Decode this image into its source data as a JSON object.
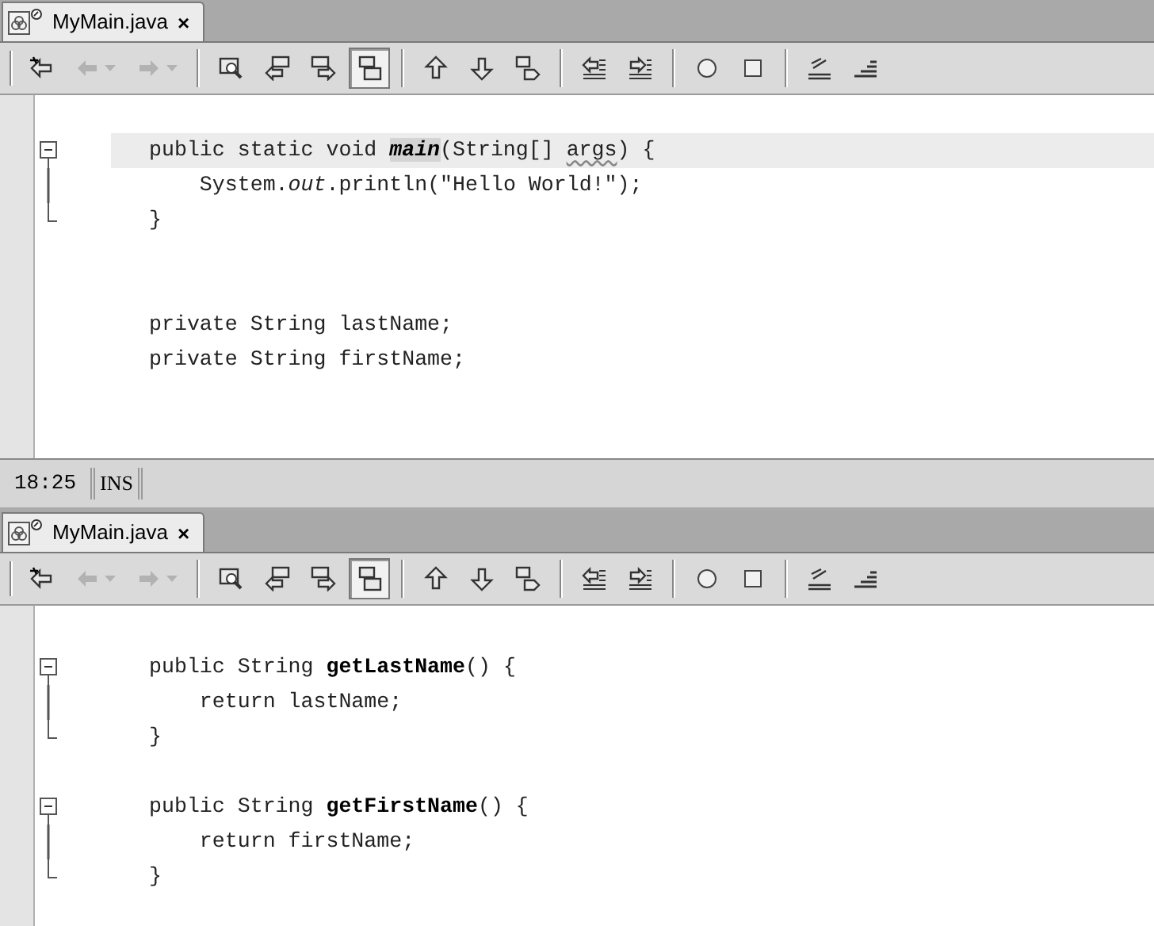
{
  "top_editor": {
    "tab": {
      "label": "MyMain.java",
      "close": "×",
      "selected": true
    },
    "toolbar": {
      "buttons": [
        {
          "pressed": false,
          "disabled": false
        },
        {
          "pressed": false,
          "disabled": true
        },
        {
          "pressed": false,
          "disabled": true
        },
        {
          "pressed": false,
          "disabled": false
        },
        {
          "pressed": false,
          "disabled": false
        },
        {
          "pressed": false,
          "disabled": false
        },
        {
          "pressed": true,
          "disabled": false
        },
        {
          "pressed": false,
          "disabled": false
        },
        {
          "pressed": false,
          "disabled": false
        },
        {
          "pressed": false,
          "disabled": false
        },
        {
          "pressed": false,
          "disabled": false
        },
        {
          "pressed": false,
          "disabled": false
        },
        {
          "pressed": false,
          "disabled": false
        },
        {
          "pressed": false,
          "disabled": false
        },
        {
          "pressed": false,
          "disabled": false
        },
        {
          "pressed": false,
          "disabled": false
        }
      ]
    },
    "lines": [
      {
        "kind": "open",
        "current": true,
        "segments": [
          {
            "text": "public static void ",
            "kind": "text"
          },
          {
            "text": "main",
            "kind": "marked"
          },
          {
            "text": "(String[] ",
            "kind": "text"
          },
          {
            "text": "args",
            "kind": "warning"
          },
          {
            "text": ") {",
            "kind": "text"
          }
        ]
      },
      {
        "kind": "body",
        "current": false,
        "segments": [
          {
            "text": "    System.",
            "kind": "text"
          },
          {
            "text": "out",
            "kind": "field"
          },
          {
            "text": ".println(\"Hello World!\");",
            "kind": "text"
          }
        ]
      },
      {
        "kind": "close",
        "current": false,
        "segments": [
          {
            "text": "}",
            "kind": "text"
          }
        ]
      },
      {
        "kind": "blank"
      },
      {
        "kind": "blank"
      },
      {
        "kind": "plain",
        "current": false,
        "segments": [
          {
            "text": "private String lastName;",
            "kind": "text"
          }
        ]
      },
      {
        "kind": "plain",
        "current": false,
        "segments": [
          {
            "text": "private String firstName;",
            "kind": "text"
          }
        ]
      }
    ]
  },
  "status_bar": {
    "position": "18:25",
    "mode": "INS"
  },
  "bottom_editor": {
    "tab": {
      "label": "MyMain.java",
      "close": "×",
      "selected": true
    },
    "toolbar": {
      "buttons": [
        {
          "pressed": false,
          "disabled": false
        },
        {
          "pressed": false,
          "disabled": true
        },
        {
          "pressed": false,
          "disabled": true
        },
        {
          "pressed": false,
          "disabled": false
        },
        {
          "pressed": false,
          "disabled": false
        },
        {
          "pressed": false,
          "disabled": false
        },
        {
          "pressed": true,
          "disabled": false
        },
        {
          "pressed": false,
          "disabled": false
        },
        {
          "pressed": false,
          "disabled": false
        },
        {
          "pressed": false,
          "disabled": false
        },
        {
          "pressed": false,
          "disabled": false
        },
        {
          "pressed": false,
          "disabled": false
        },
        {
          "pressed": false,
          "disabled": false
        },
        {
          "pressed": false,
          "disabled": false
        },
        {
          "pressed": false,
          "disabled": false
        },
        {
          "pressed": false,
          "disabled": false
        }
      ]
    },
    "lines": [
      {
        "kind": "open",
        "current": false,
        "segments": [
          {
            "text": "public String ",
            "kind": "text"
          },
          {
            "text": "getLastName",
            "kind": "method"
          },
          {
            "text": "() {",
            "kind": "text"
          }
        ]
      },
      {
        "kind": "body",
        "current": false,
        "segments": [
          {
            "text": "    return lastName;",
            "kind": "text"
          }
        ]
      },
      {
        "kind": "close",
        "current": false,
        "segments": [
          {
            "text": "}",
            "kind": "text"
          }
        ]
      },
      {
        "kind": "blank"
      },
      {
        "kind": "open",
        "current": false,
        "segments": [
          {
            "text": "public String ",
            "kind": "text"
          },
          {
            "text": "getFirstName",
            "kind": "method"
          },
          {
            "text": "() {",
            "kind": "text"
          }
        ]
      },
      {
        "kind": "body",
        "current": false,
        "segments": [
          {
            "text": "    return firstName;",
            "kind": "text"
          }
        ]
      },
      {
        "kind": "close",
        "current": false,
        "segments": [
          {
            "text": "}",
            "kind": "text"
          }
        ]
      }
    ]
  }
}
